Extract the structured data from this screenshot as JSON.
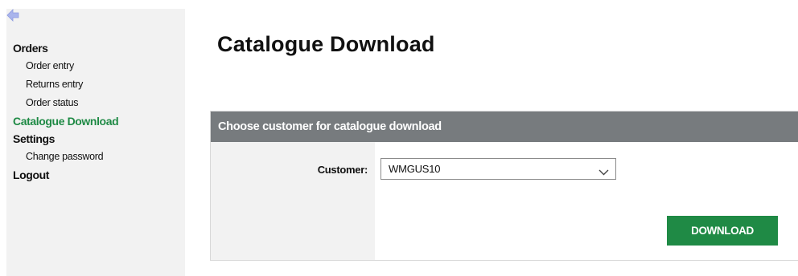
{
  "sidebar": {
    "back_icon": "arrow-left-icon",
    "sections": [
      {
        "label": "Orders",
        "active": false,
        "items": [
          "Order entry",
          "Returns entry",
          "Order status"
        ]
      },
      {
        "label": "Catalogue Download",
        "active": true,
        "items": []
      },
      {
        "label": "Settings",
        "active": false,
        "items": [
          "Change password"
        ]
      },
      {
        "label": "Logout",
        "active": false,
        "items": []
      }
    ]
  },
  "main": {
    "title": "Catalogue Download",
    "panel": {
      "header": "Choose customer for catalogue download",
      "customer_label": "Customer:",
      "customer_value": "WMGUS10",
      "download_label": "DOWNLOAD"
    }
  },
  "colors": {
    "accent_green": "#1f8a45",
    "panel_header_bg": "#777b7e",
    "sidebar_bg": "#f2f2f2",
    "back_arrow": "#a9b4ec"
  }
}
